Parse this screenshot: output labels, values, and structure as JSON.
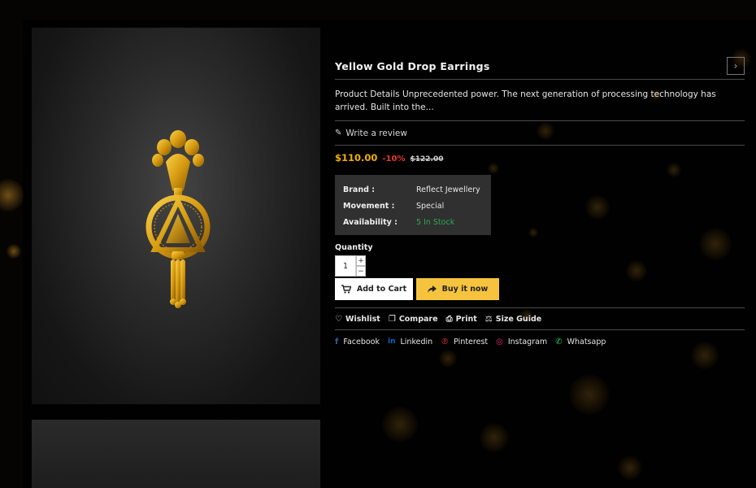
{
  "product": {
    "title": "Yellow Gold Drop Earrings",
    "next_icon": "chevron-right-icon",
    "next_glyph": "›",
    "description": "Product Details Unprecedented power. The next generation of processing technology has arrived. Built into the...",
    "review_label": "Write a review",
    "price": "$110.00",
    "discount": "-10%",
    "old_price": "$122.00"
  },
  "specs": [
    {
      "key": "Brand :",
      "value": "Reflect Jewellery"
    },
    {
      "key": "Movement :",
      "value": "Special"
    },
    {
      "key": "Availability :",
      "value": "5 In Stock"
    }
  ],
  "quantity": {
    "label": "Quantity",
    "value": "1",
    "plus": "+",
    "minus": "−"
  },
  "buttons": {
    "add_to_cart": "Add to Cart",
    "buy_now": "Buy it now"
  },
  "links": {
    "wishlist": "Wishlist",
    "compare": "Compare",
    "print": "Print",
    "size_guide": "Size Guide"
  },
  "social": {
    "facebook": "Facebook",
    "linkedin": "Linkedin",
    "pinterest": "Pinterest",
    "instagram": "Instagram",
    "whatsapp": "Whatsapp"
  },
  "colors": {
    "price": "#f0b000",
    "discount": "#e53a2e",
    "in_stock": "#2ea84f",
    "buy_button": "#f6c33e",
    "facebook": "#3b5998",
    "linkedin": "#0a66c2",
    "pinterest": "#e02d2d",
    "instagram": "#e1306c",
    "whatsapp": "#25d366"
  }
}
